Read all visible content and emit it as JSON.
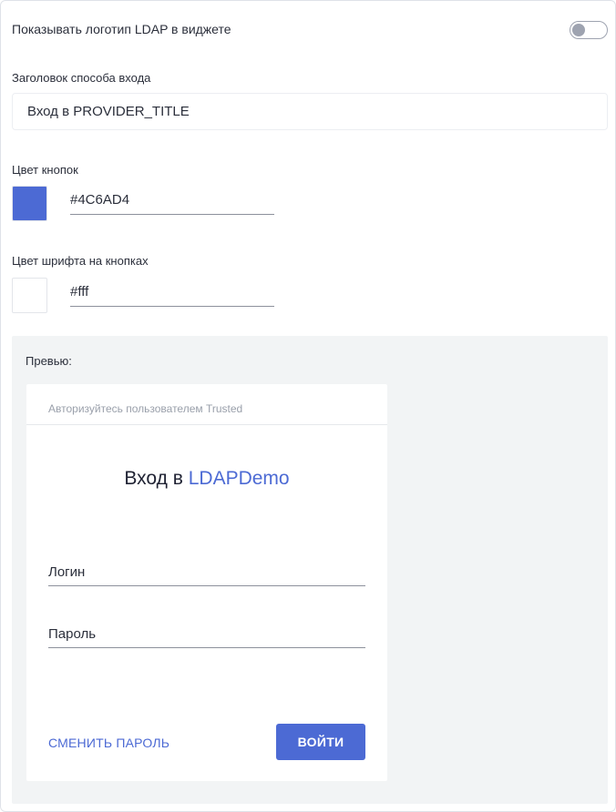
{
  "settings": {
    "show_logo_label": "Показывать логотип LDAP в виджете",
    "show_logo_enabled": false,
    "login_title_label": "Заголовок способа входа",
    "login_title_value": "Вход в PROVIDER_TITLE",
    "button_color_label": "Цвет кнопок",
    "button_color_value": "#4C6AD4",
    "font_color_label": "Цвет шрифта на кнопках",
    "font_color_value": "#fff"
  },
  "preview": {
    "label": "Превью:",
    "header_text": "Авторизуйтесь пользователем Trusted",
    "title_prefix": "Вход в",
    "provider_name": "LDAPDemo",
    "login_label": "Логин",
    "password_label": "Пароль",
    "change_password_label": "СМЕНИТЬ ПАРОЛЬ",
    "submit_label": "ВОЙТИ"
  },
  "colors": {
    "accent": "#4C6AD4",
    "button_text": "#ffffff",
    "preview_background": "#f2f4f5",
    "toggle_off": "#9ea3b0"
  }
}
